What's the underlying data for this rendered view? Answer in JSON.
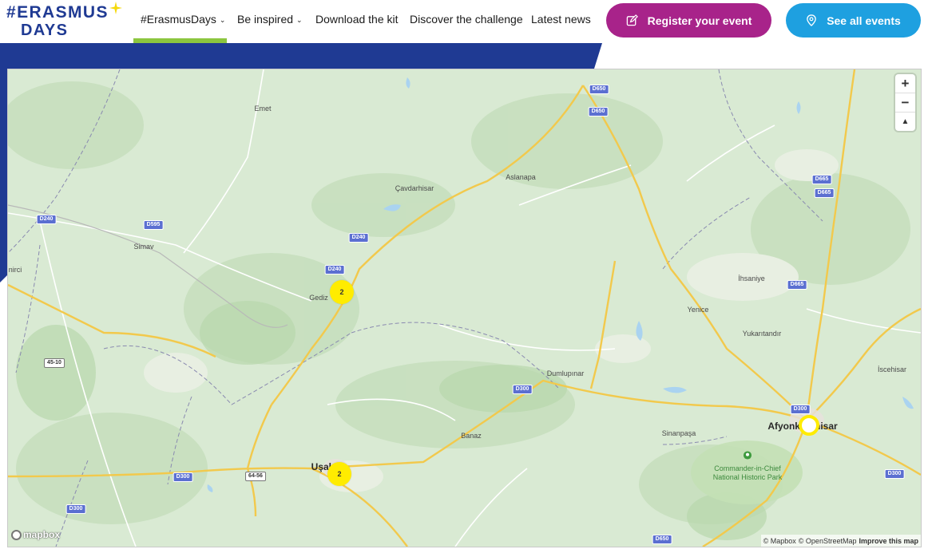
{
  "header": {
    "logo": {
      "line1": "#ERASMUS",
      "line2": "DAYS"
    },
    "nav": [
      {
        "label": "#ErasmusDays",
        "dropdown": true,
        "active": true
      },
      {
        "label": "Be inspired",
        "dropdown": true
      },
      {
        "label": "Download the kit"
      },
      {
        "label": "Discover the challenge"
      },
      {
        "label": "Latest news"
      }
    ],
    "buttons": {
      "register": {
        "label": "Register your event",
        "icon": "edit-icon",
        "color": "#a8238a"
      },
      "see_events": {
        "label": "See all events",
        "icon": "location-pin-icon",
        "color": "#1ea0e0"
      }
    },
    "colors": {
      "brand_blue": "#1f3a93",
      "active_green": "#8cc63f"
    }
  },
  "map": {
    "places": [
      {
        "name": "Emet"
      },
      {
        "name": "Çavdarhisar"
      },
      {
        "name": "Aslanapa"
      },
      {
        "name": "Simav"
      },
      {
        "name": "nirci"
      },
      {
        "name": "Gediz"
      },
      {
        "name": "İhsaniye"
      },
      {
        "name": "Yenice"
      },
      {
        "name": "Yukarıtandır"
      },
      {
        "name": "İscehisar"
      },
      {
        "name": "Dumlupınar"
      },
      {
        "name": "Banaz"
      },
      {
        "name": "Sinanpaşa"
      },
      {
        "name": "Uşak"
      },
      {
        "name": "Afyonkarahisar"
      }
    ],
    "park": "Commander-in-Chief National Historic Park",
    "road_shields": [
      "D650",
      "D650",
      "D665",
      "D665",
      "D665",
      "D240",
      "D595",
      "D240",
      "D240",
      "45-10",
      "D300",
      "D300",
      "D300",
      "64-56",
      "D300",
      "D300",
      "D650"
    ],
    "clusters": [
      {
        "count": "2",
        "near": "Gediz"
      },
      {
        "count": "2",
        "near": "Uşak"
      }
    ],
    "single_marker": {
      "near": "Afyonkarahisar"
    },
    "controls": {
      "zoom_in": "+",
      "zoom_out": "−",
      "compass": "▲"
    },
    "logo": "mapbox",
    "attribution": {
      "mapbox": "© Mapbox",
      "osm": "© OpenStreetMap",
      "improve": "Improve this map"
    },
    "marker_color": "#ffec00"
  }
}
